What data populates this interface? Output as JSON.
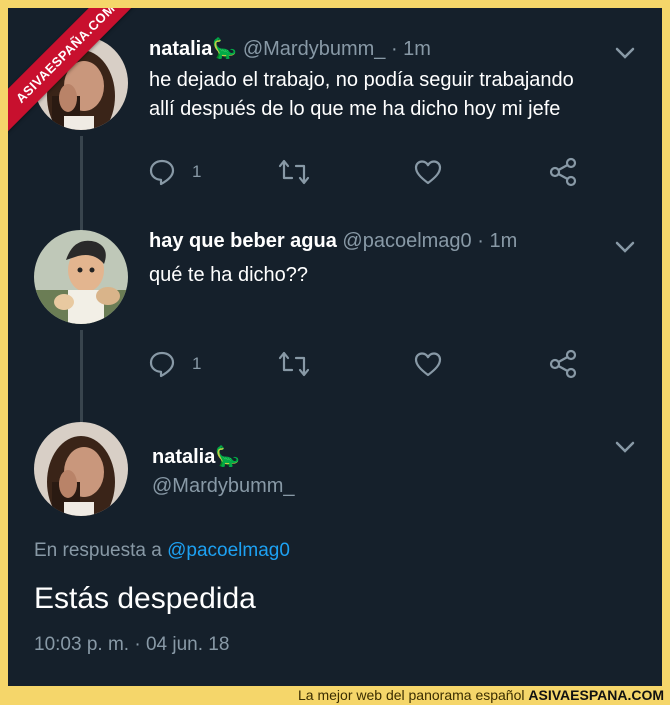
{
  "watermark": {
    "ribbon_text": "ASIVAESPAÑA.COM"
  },
  "tweets": [
    {
      "name": "natalia",
      "emoji": "🦕",
      "handle": "@Mardybumm_",
      "time": "· 1m",
      "lines": [
        "he dejado el trabajo, no podía seguir trabajando",
        "allí después de lo que me ha dicho hoy mi jefe"
      ],
      "reply_count": "1"
    },
    {
      "name": "hay que beber agua",
      "handle": "@pacoelmag0",
      "time": "· 1m",
      "lines": [
        "qué te ha dicho??"
      ],
      "reply_count": "1"
    }
  ],
  "focus_tweet": {
    "name": "natalia",
    "emoji": "🦕",
    "handle": "@Mardybumm_",
    "reply_prefix": "En respuesta a",
    "reply_to": "@pacoelmag0",
    "text": "Estás despedida",
    "timestamp": "10:03 p. m. · 04 jun. 18"
  },
  "footer": {
    "tagline": "La mejor web del panorama español",
    "brand": "ASIVAESPANA.COM"
  },
  "colors": {
    "background": "#15202b",
    "text": "#ffffff",
    "secondary": "#8899a6",
    "link": "#1da1f2",
    "page_border": "#f5d66a",
    "ribbon": "#c8102e"
  }
}
